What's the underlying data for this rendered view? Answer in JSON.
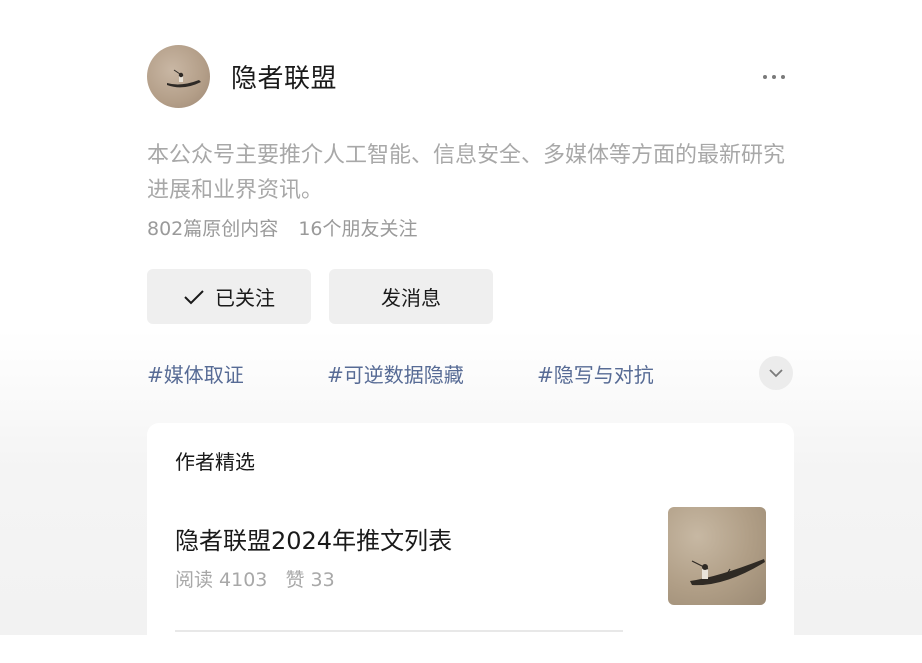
{
  "profile": {
    "name": "隐者联盟",
    "avatar_icon": "painting-fisherman-boat",
    "description": "本公众号主要推介人工智能、信息安全、多媒体等方面的最新研究进展和业界资讯。",
    "original_count": "802篇原创内容",
    "friends_following": "16个朋友关注"
  },
  "actions": {
    "follow_label": "已关注",
    "message_label": "发消息",
    "more_icon": "more-dots-icon"
  },
  "tags": [
    "#媒体取证",
    "#可逆数据隐藏",
    "#隐写与对抗"
  ],
  "featured": {
    "section_title": "作者精选",
    "articles": [
      {
        "title": "隐者联盟2024年推文列表",
        "reads": "阅读 4103",
        "likes": "赞 33"
      }
    ]
  },
  "colors": {
    "tag": "#576b95",
    "button_bg": "#efefef",
    "muted_text": "#a8a8a8"
  }
}
